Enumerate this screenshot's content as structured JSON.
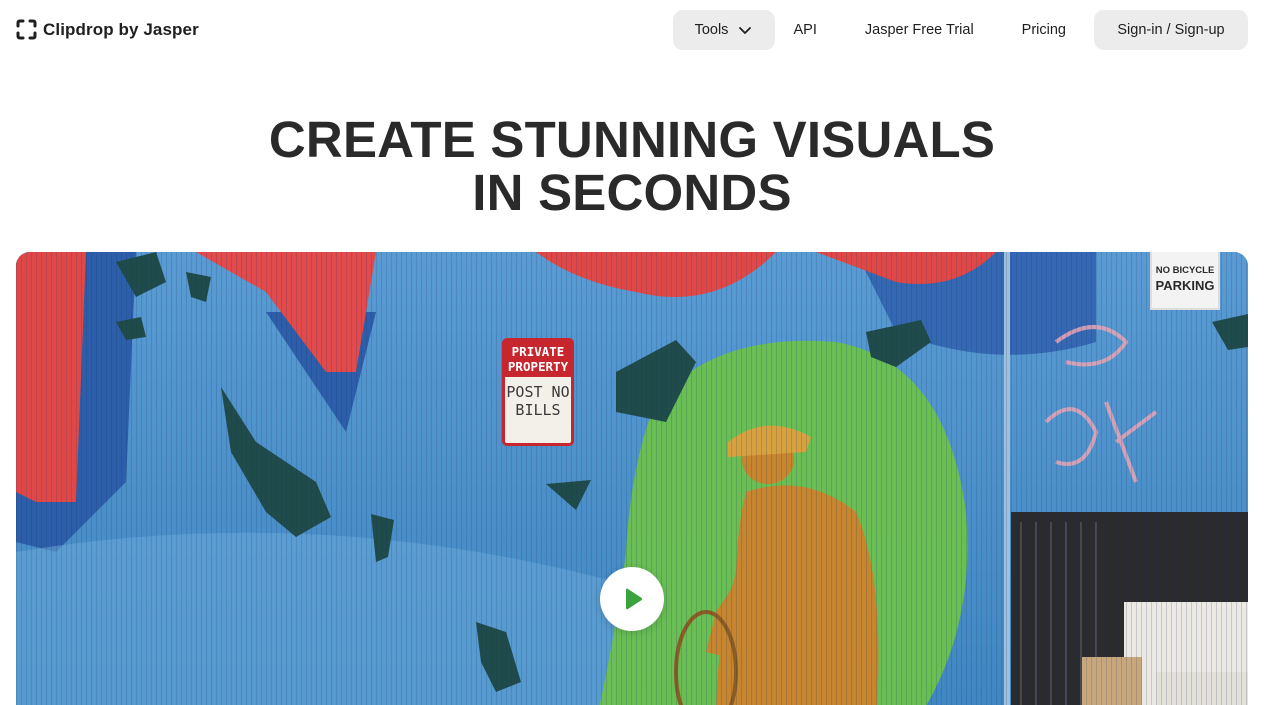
{
  "header": {
    "brand_name": "Clipdrop by Jasper",
    "nav": {
      "tools_label": "Tools",
      "api_label": "API",
      "trial_label": "Jasper Free Trial",
      "pricing_label": "Pricing",
      "signin_label": "Sign-in / Sign-up"
    }
  },
  "hero": {
    "title_line1": "CREATE STUNNING VISUALS",
    "title_line2": "IN SECONDS"
  },
  "media": {
    "sign_private_top": "PRIVATE PROPERTY",
    "sign_private_bottom": "POST NO BILLS",
    "sign_bike_line1": "NO BICYCLE",
    "sign_bike_line2": "PARKING",
    "play_icon": "play-icon"
  },
  "colors": {
    "button_bg": "#ececec",
    "title": "#2a2a2a",
    "wall_blue": "#4b8fc9",
    "mural_red": "#e2474b",
    "highlight_green": "#6cc24a",
    "person_orange": "#c7852f"
  }
}
